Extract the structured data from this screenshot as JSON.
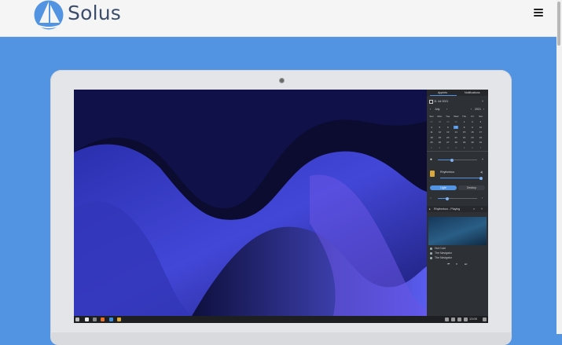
{
  "brand": {
    "name": "Solus",
    "logo_icon": "solus-sail-logo-icon"
  },
  "header": {
    "menu_icon": "hamburger-menu-icon"
  },
  "colors": {
    "page_bg": "#5294e2",
    "header_bg": "#f5f5f5",
    "accent": "#5294e2",
    "panel_bg": "#2d3035"
  },
  "raven": {
    "tabs": [
      "Applets",
      "Notifications"
    ],
    "calendar": {
      "date_label": "11 Jul 2021",
      "month": "July",
      "year": "2021",
      "weekdays": [
        "Sun",
        "Mon",
        "Tue",
        "Wed",
        "Thu",
        "Fri",
        "Sat"
      ],
      "days": [
        "27",
        "28",
        "29",
        "30",
        "1",
        "2",
        "3",
        "4",
        "5",
        "6",
        "7",
        "8",
        "9",
        "10",
        "11",
        "12",
        "13",
        "14",
        "15",
        "16",
        "17",
        "18",
        "19",
        "20",
        "21",
        "22",
        "23",
        "24",
        "25",
        "26",
        "27",
        "28",
        "29",
        "30",
        "31",
        "1",
        "2",
        "3",
        "4",
        "5",
        "6",
        "7"
      ],
      "selected_day": "11"
    },
    "sound": {
      "app_name": "Rhythmbox",
      "left_button": "Light",
      "right_button": "Desktop"
    },
    "media": {
      "title": "Rhythmbox - Playing",
      "tracks": [
        "Hot Cold",
        "The Navigator",
        "The Navigator"
      ]
    }
  },
  "taskbar": {
    "clock": "13:00"
  }
}
